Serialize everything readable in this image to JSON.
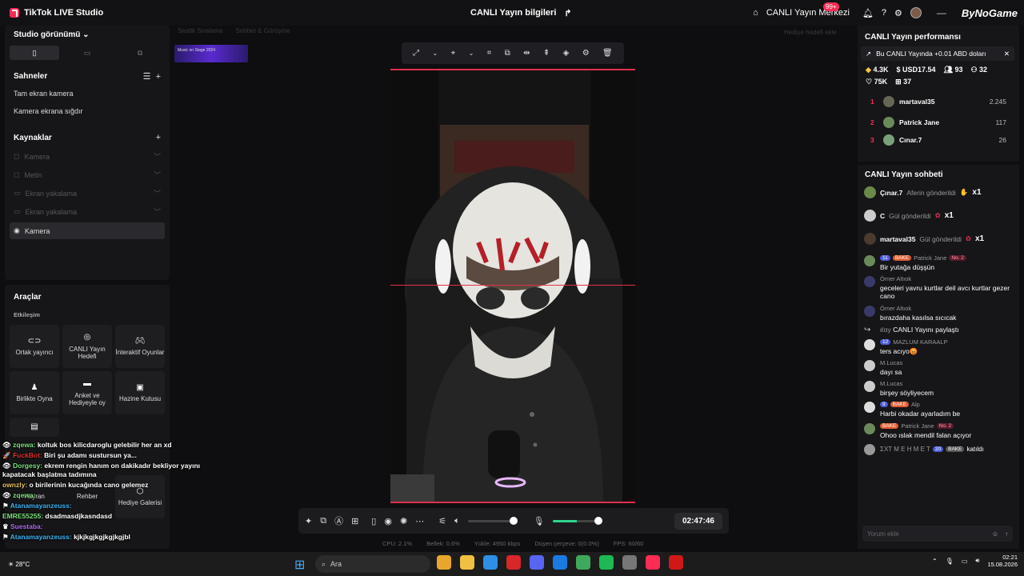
{
  "app": {
    "title": "TikTok LIVE Studio",
    "center_title": "CANLI Yayın bilgileri",
    "live_center": "CANLI Yayın Merkezi",
    "notif_count": "99+",
    "watermark": "ByNoGame"
  },
  "left": {
    "studio_view": "Studio görünümü",
    "scenes_title": "Sahneler",
    "scenes": [
      "Tam ekran kamera",
      "Kamera ekrana sığdır"
    ],
    "sources_title": "Kaynaklar",
    "sources": [
      "Kamera",
      "Metin",
      "Ekran yakalama",
      "Ekran yakalama"
    ],
    "active_source": "Kamera",
    "tools_title": "Araçlar",
    "engagement": "Etkileşim",
    "tools": [
      "Ortak yayıncı",
      "CANLI Yayın Hedefi",
      "İnteraktif Oyunlar",
      "Birlikte Oyna",
      "Anket ve Hediyeyle oy",
      "Hazine Kutusu",
      "Hayran",
      "Rehber",
      "Hediye Galerisi"
    ]
  },
  "overlay_chat": [
    {
      "user": "zqewa:",
      "text": "koltuk bos kilicdaroglu gelebilir her an xd"
    },
    {
      "user": "FuckBot:",
      "text": "Biri şu adamı sustursun ya..."
    },
    {
      "user": "Dorgesy:",
      "text": "ekrem rengin hanım on dakikadır bekliyor yayını kapatacak başlatma tadımına"
    },
    {
      "user": "ownzly:",
      "text": "o birilerinin kucağında cano gelemez"
    },
    {
      "user": "zqewa:",
      "text": ""
    },
    {
      "user": "Atanamayanzeuss:",
      "text": ""
    },
    {
      "user": "EMRE55255:",
      "text": "dsadmasdjkasndasd"
    },
    {
      "user": "Suestaba:",
      "text": ""
    },
    {
      "user": "Atanamayanzeuss:",
      "text": "kjkjkgjkgjkgjkgjbl"
    }
  ],
  "canvas": {
    "chip1": "Seatik Sıralama",
    "chip2": "Sohbet & Görüşme",
    "gift_target": "Hediye hedefi ekle",
    "thumb_text": "Music on Stage 2024"
  },
  "controls": {
    "timer": "02:47:46"
  },
  "stats": {
    "cpu": "CPU: 2.1%",
    "memory": "Bellek: 0.6%",
    "upload": "Yükle: 4950 kbps",
    "dropped": "Düşen çerçeve: 0(0.0%)",
    "fps": "FPS: 60/60"
  },
  "right": {
    "perf_title": "CANLI Yayın performansı",
    "perf_banner": "Bu CANLI Yayında +0.01 ABD doları",
    "metrics": [
      "4.3K",
      "USD17.54",
      "93",
      "32",
      "75K",
      "37"
    ],
    "ranking": [
      {
        "rank": "1",
        "name": "martaval35",
        "score": "2.245"
      },
      {
        "rank": "2",
        "name": "Patrick Jane",
        "score": "117"
      },
      {
        "rank": "3",
        "name": "Cınar.7",
        "score": "26"
      }
    ],
    "chat_title": "CANLI Yayın sohbeti",
    "gifts": [
      {
        "name": "Çınar.7",
        "text": "Aferin gönderildi",
        "count": "x1"
      },
      {
        "name": "C",
        "text": "Gül gönderildi",
        "count": "x1"
      },
      {
        "name": "martaval35",
        "text": "Gül gönderildi",
        "count": "x1"
      }
    ],
    "messages": [
      {
        "lvl": "11",
        "tag": "BAKE",
        "name": "Patrick Jane",
        "rank": "No. 2",
        "body": "Bir yutağa düşşün"
      },
      {
        "lvl": "",
        "tag": "",
        "name": "Ömer Altıok",
        "rank": "",
        "body": "geceleri yavru kurtlar deil avcı kurtlar gezer cano"
      },
      {
        "lvl": "",
        "tag": "",
        "name": "Ömer Altıok",
        "rank": "",
        "body": "bırazdaha kasılsa sıcıcak"
      },
      {
        "lvl": "",
        "tag": "",
        "name": "ιℓαу",
        "rank": "",
        "body": "CANLI Yayını paylaştı"
      },
      {
        "lvl": "12",
        "tag": "",
        "name": "MAZLUM KARAALP",
        "rank": "",
        "body": "ters acıyo😡"
      },
      {
        "lvl": "",
        "tag": "",
        "name": "M.Lucas",
        "rank": "",
        "body": "dayı sa"
      },
      {
        "lvl": "",
        "tag": "",
        "name": "M.Lucas",
        "rank": "",
        "body": "birşey söyliyecem"
      },
      {
        "lvl": "9",
        "tag": "BAKE",
        "name": "Alp",
        "rank": "",
        "body": "Harbi okadar ayarladım be"
      },
      {
        "lvl": "",
        "tag": "BAKE",
        "name": "Patrick Jane",
        "rank": "No. 2",
        "body": "Ohoo ıslak mendil falan açıyor"
      }
    ],
    "last_join": {
      "name": "ΣΧΤ Μ Ε Η Μ Ε Τ",
      "lvl": "20",
      "tag": "BAKE",
      "text": "katıldı"
    },
    "comment_placeholder": "Yorum ekle"
  },
  "taskbar": {
    "search": "Ara",
    "weather": "28°C",
    "time": "02:21",
    "date": "15.08.2026"
  }
}
